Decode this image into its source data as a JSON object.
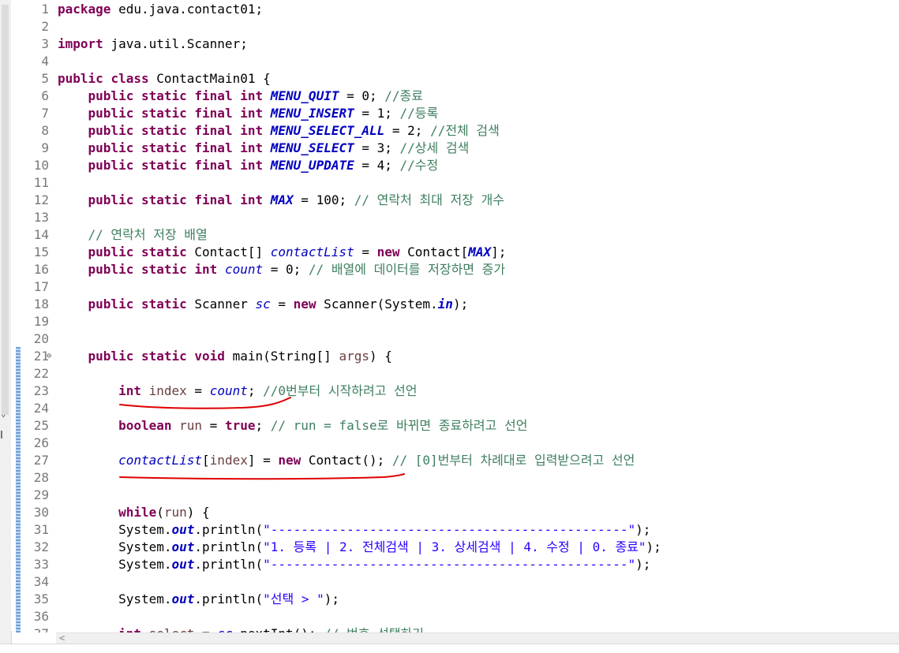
{
  "editor": {
    "lines": [
      {
        "n": "1",
        "tokens": [
          [
            "kw",
            "package"
          ],
          [
            "",
            ""
          ],
          [
            "",
            "edu.java.contact01;"
          ]
        ]
      },
      {
        "n": "2",
        "tokens": []
      },
      {
        "n": "3",
        "tokens": [
          [
            "kw",
            "import"
          ],
          [
            "",
            ""
          ],
          [
            "",
            "java.util.Scanner;"
          ]
        ]
      },
      {
        "n": "4",
        "tokens": []
      },
      {
        "n": "5",
        "tokens": [
          [
            "kw",
            "public"
          ],
          [
            "",
            ""
          ],
          [
            "kw",
            "class"
          ],
          [
            "",
            ""
          ],
          [
            "",
            "ContactMain01 {"
          ]
        ]
      },
      {
        "n": "6",
        "tokens": [
          [
            "",
            "    "
          ],
          [
            "kw",
            "public"
          ],
          [
            "",
            ""
          ],
          [
            "kw",
            "static"
          ],
          [
            "",
            ""
          ],
          [
            "kw",
            "final"
          ],
          [
            "",
            ""
          ],
          [
            "kw",
            "int"
          ],
          [
            "",
            ""
          ],
          [
            "cn",
            "MENU_QUIT"
          ],
          [
            "",
            " = 0; "
          ],
          [
            "cm",
            "//종료"
          ]
        ]
      },
      {
        "n": "7",
        "tokens": [
          [
            "",
            "    "
          ],
          [
            "kw",
            "public"
          ],
          [
            "",
            ""
          ],
          [
            "kw",
            "static"
          ],
          [
            "",
            ""
          ],
          [
            "kw",
            "final"
          ],
          [
            "",
            ""
          ],
          [
            "kw",
            "int"
          ],
          [
            "",
            ""
          ],
          [
            "cn",
            "MENU_INSERT"
          ],
          [
            "",
            " = 1; "
          ],
          [
            "cm",
            "//등록"
          ]
        ]
      },
      {
        "n": "8",
        "tokens": [
          [
            "",
            "    "
          ],
          [
            "kw",
            "public"
          ],
          [
            "",
            ""
          ],
          [
            "kw",
            "static"
          ],
          [
            "",
            ""
          ],
          [
            "kw",
            "final"
          ],
          [
            "",
            ""
          ],
          [
            "kw",
            "int"
          ],
          [
            "",
            ""
          ],
          [
            "cn",
            "MENU_SELECT_ALL"
          ],
          [
            "",
            " = 2; "
          ],
          [
            "cm",
            "//전체 검색"
          ]
        ]
      },
      {
        "n": "9",
        "tokens": [
          [
            "",
            "    "
          ],
          [
            "kw",
            "public"
          ],
          [
            "",
            ""
          ],
          [
            "kw",
            "static"
          ],
          [
            "",
            ""
          ],
          [
            "kw",
            "final"
          ],
          [
            "",
            ""
          ],
          [
            "kw",
            "int"
          ],
          [
            "",
            ""
          ],
          [
            "cn",
            "MENU_SELECT"
          ],
          [
            "",
            " = 3; "
          ],
          [
            "cm",
            "//상세 검색"
          ]
        ]
      },
      {
        "n": "10",
        "tokens": [
          [
            "",
            "    "
          ],
          [
            "kw",
            "public"
          ],
          [
            "",
            ""
          ],
          [
            "kw",
            "static"
          ],
          [
            "",
            ""
          ],
          [
            "kw",
            "final"
          ],
          [
            "",
            ""
          ],
          [
            "kw",
            "int"
          ],
          [
            "",
            ""
          ],
          [
            "cn",
            "MENU_UPDATE"
          ],
          [
            "",
            " = 4; "
          ],
          [
            "cm",
            "//수정"
          ]
        ]
      },
      {
        "n": "11",
        "tokens": []
      },
      {
        "n": "12",
        "tokens": [
          [
            "",
            "    "
          ],
          [
            "kw",
            "public"
          ],
          [
            "",
            ""
          ],
          [
            "kw",
            "static"
          ],
          [
            "",
            ""
          ],
          [
            "kw",
            "final"
          ],
          [
            "",
            ""
          ],
          [
            "kw",
            "int"
          ],
          [
            "",
            ""
          ],
          [
            "cn",
            "MAX"
          ],
          [
            "",
            " = 100; "
          ],
          [
            "cm",
            "// 연락처 최대 저장 개수"
          ]
        ]
      },
      {
        "n": "13",
        "tokens": []
      },
      {
        "n": "14",
        "tokens": [
          [
            "",
            "    "
          ],
          [
            "cm",
            "// 연락처 저장 배열"
          ]
        ]
      },
      {
        "n": "15",
        "tokens": [
          [
            "",
            "    "
          ],
          [
            "kw",
            "public"
          ],
          [
            "",
            ""
          ],
          [
            "kw",
            "static"
          ],
          [
            "",
            ""
          ],
          [
            "",
            "Contact[] "
          ],
          [
            "sf",
            "contactList"
          ],
          [
            "",
            " = "
          ],
          [
            "kw",
            "new"
          ],
          [
            "",
            " Contact["
          ],
          [
            "cn",
            "MAX"
          ],
          [
            "",
            "];"
          ]
        ]
      },
      {
        "n": "16",
        "tokens": [
          [
            "",
            "    "
          ],
          [
            "kw",
            "public"
          ],
          [
            "",
            ""
          ],
          [
            "kw",
            "static"
          ],
          [
            "",
            ""
          ],
          [
            "kw",
            "int"
          ],
          [
            "",
            ""
          ],
          [
            "sf",
            "count"
          ],
          [
            "",
            " = 0; "
          ],
          [
            "cm",
            "// 배열에 데이터를 저장하면 증가"
          ]
        ]
      },
      {
        "n": "17",
        "tokens": []
      },
      {
        "n": "18",
        "tokens": [
          [
            "",
            "    "
          ],
          [
            "kw",
            "public"
          ],
          [
            "",
            ""
          ],
          [
            "kw",
            "static"
          ],
          [
            "",
            ""
          ],
          [
            "",
            "Scanner "
          ],
          [
            "sf",
            "sc"
          ],
          [
            "",
            " = "
          ],
          [
            "kw",
            "new"
          ],
          [
            "",
            " Scanner(System."
          ],
          [
            "cn",
            "in"
          ],
          [
            "",
            ");"
          ]
        ]
      },
      {
        "n": "19",
        "tokens": []
      },
      {
        "n": "20",
        "tokens": []
      },
      {
        "n": "21",
        "tokens": [
          [
            "",
            "    "
          ],
          [
            "kw",
            "public"
          ],
          [
            "",
            ""
          ],
          [
            "kw",
            "static"
          ],
          [
            "",
            ""
          ],
          [
            "kw",
            "void"
          ],
          [
            "",
            " main(String[] "
          ],
          [
            "lv",
            "args"
          ],
          [
            "",
            ") {"
          ]
        ]
      },
      {
        "n": "22",
        "tokens": []
      },
      {
        "n": "23",
        "tokens": [
          [
            "",
            "        "
          ],
          [
            "kw",
            "int"
          ],
          [
            "",
            ""
          ],
          [
            "lv",
            "index"
          ],
          [
            "",
            " = "
          ],
          [
            "sf",
            "count"
          ],
          [
            "",
            "; "
          ],
          [
            "cm",
            "//0번부터 시작하려고 선언"
          ]
        ]
      },
      {
        "n": "24",
        "tokens": []
      },
      {
        "n": "25",
        "tokens": [
          [
            "",
            "        "
          ],
          [
            "kw",
            "boolean"
          ],
          [
            "",
            ""
          ],
          [
            "lv",
            "run"
          ],
          [
            "",
            " = "
          ],
          [
            "kw",
            "true"
          ],
          [
            "",
            "; "
          ],
          [
            "cm",
            "// run = false로 바뀌면 종료하려고 선언"
          ]
        ]
      },
      {
        "n": "26",
        "tokens": []
      },
      {
        "n": "27",
        "tokens": [
          [
            "",
            "        "
          ],
          [
            "sf",
            "contactList"
          ],
          [
            "",
            "["
          ],
          [
            "lv",
            "index"
          ],
          [
            "",
            "] = "
          ],
          [
            "kw",
            "new"
          ],
          [
            "",
            " Contact(); "
          ],
          [
            "cm",
            "// [0]번부터 차례대로 입력받으려고 선언"
          ]
        ]
      },
      {
        "n": "28",
        "tokens": []
      },
      {
        "n": "29",
        "tokens": []
      },
      {
        "n": "30",
        "tokens": [
          [
            "",
            "        "
          ],
          [
            "kw",
            "while"
          ],
          [
            "",
            "("
          ],
          [
            "lv",
            "run"
          ],
          [
            "",
            ") {"
          ]
        ]
      },
      {
        "n": "31",
        "tokens": [
          [
            "",
            "        System."
          ],
          [
            "cn",
            "out"
          ],
          [
            "",
            ".println("
          ],
          [
            "st",
            "\"-----------------------------------------------\""
          ],
          [
            "",
            ");"
          ]
        ]
      },
      {
        "n": "32",
        "tokens": [
          [
            "",
            "        System."
          ],
          [
            "cn",
            "out"
          ],
          [
            "",
            ".println("
          ],
          [
            "st",
            "\"1. 등록 | 2. 전체검색 | 3. 상세검색 | 4. 수정 | 0. 종료\""
          ],
          [
            "",
            ");"
          ]
        ]
      },
      {
        "n": "33",
        "tokens": [
          [
            "",
            "        System."
          ],
          [
            "cn",
            "out"
          ],
          [
            "",
            ".println("
          ],
          [
            "st",
            "\"-----------------------------------------------\""
          ],
          [
            "",
            ");"
          ]
        ]
      },
      {
        "n": "34",
        "tokens": []
      },
      {
        "n": "35",
        "tokens": [
          [
            "",
            "        System."
          ],
          [
            "cn",
            "out"
          ],
          [
            "",
            ".println("
          ],
          [
            "st",
            "\"선택 > \""
          ],
          [
            "",
            ");"
          ]
        ]
      },
      {
        "n": "36",
        "tokens": []
      },
      {
        "n": "37",
        "tokens": [
          [
            "",
            "        "
          ],
          [
            "kw",
            "int"
          ],
          [
            "",
            ""
          ],
          [
            "lv",
            "select"
          ],
          [
            "",
            " = "
          ],
          [
            "sf",
            "sc"
          ],
          [
            "",
            ".nextInt(); "
          ],
          [
            "cm",
            "// 번호 선택하기"
          ]
        ]
      }
    ]
  },
  "colors": {
    "keyword": "#7f0055",
    "static_field": "#0000c0",
    "comment": "#3f7f5f",
    "string": "#2a00ff",
    "local_var": "#6a3e3e",
    "annotation_ink": "#e00000"
  },
  "icons": {
    "fold": "collapse-fold-icon",
    "scroll_left": "scroll-left-arrow-icon",
    "left_chevron": "chevron-down-icon"
  },
  "glyphs": {
    "fold": "⊖",
    "scroll_left": "<",
    "left_chevron": "⌄"
  }
}
